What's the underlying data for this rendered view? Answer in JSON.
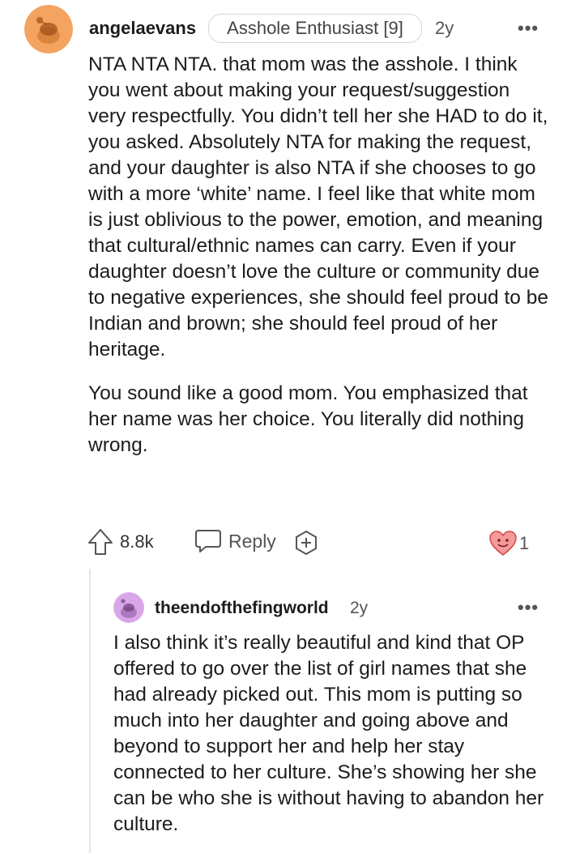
{
  "comment": {
    "username": "angelaevans",
    "flair": "Asshole Enthusiast [9]",
    "age": "2y",
    "more": "•••",
    "paragraphs": [
      "NTA NTA NTA. that mom was the asshole. I think you went about making your request/suggestion very respectfully. You didn’t tell her she HAD to do it, you asked. Absolutely NTA for making the request, and your daughter is also NTA if she chooses to go with a more ‘white’ name. I feel like that white mom is just oblivious to the power, emotion, and meaning that cultural/ethnic names can carry. Even if your daughter doesn’t love the culture or community due to negative experiences, she should feel proud to be Indian and brown; she should feel proud of her heritage.",
      "You sound like a good mom. You emphasized that her name was her choice. You literally did nothing wrong."
    ],
    "upvotes": "8.8k",
    "reply_label": "Reply",
    "award_count": "1",
    "avatar_color": "#f4a460"
  },
  "reply": {
    "username": "theendofthefingworld",
    "age": "2y",
    "more": "•••",
    "text": "I also think it’s really beautiful and kind that OP offered to go over the list of girl names that she had already picked out. This mom is putting so much into her daughter and going above and beyond to support her and help her stay connected to her culture. She’s showing her she can be who she is without having to abandon her culture.",
    "avatar_color": "#d9a6e8"
  }
}
